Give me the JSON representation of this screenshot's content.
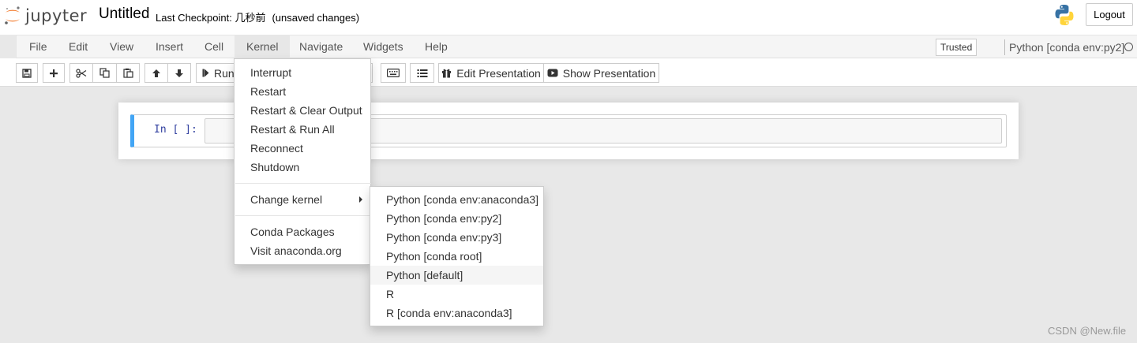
{
  "header": {
    "logo_text": "jupyter",
    "notebook_title": "Untitled",
    "checkpoint_text": "Last Checkpoint: 几秒前",
    "unsaved_text": "(unsaved changes)",
    "logout_label": "Logout"
  },
  "menubar": {
    "items": [
      {
        "label": "File"
      },
      {
        "label": "Edit"
      },
      {
        "label": "View"
      },
      {
        "label": "Insert"
      },
      {
        "label": "Cell"
      },
      {
        "label": "Kernel"
      },
      {
        "label": "Navigate"
      },
      {
        "label": "Widgets"
      },
      {
        "label": "Help"
      }
    ],
    "active_menu": "Kernel",
    "trusted_label": "Trusted",
    "kernel_name": "Python [conda env:py2]"
  },
  "toolbar": {
    "run_label": "Run",
    "edit_presentation_label": "Edit Presentation",
    "show_presentation_label": "Show Presentation"
  },
  "cell": {
    "prompt": "In [ ]:",
    "content": ""
  },
  "kernel_menu": {
    "items": [
      {
        "label": "Interrupt"
      },
      {
        "label": "Restart"
      },
      {
        "label": "Restart & Clear Output"
      },
      {
        "label": "Restart & Run All"
      },
      {
        "label": "Reconnect"
      },
      {
        "label": "Shutdown"
      },
      {
        "label": "Change kernel"
      },
      {
        "label": "Conda Packages"
      },
      {
        "label": "Visit anaconda.org"
      }
    ]
  },
  "change_kernel_submenu": {
    "items": [
      {
        "label": "Python [conda env:anaconda3]"
      },
      {
        "label": "Python [conda env:py2]"
      },
      {
        "label": "Python [conda env:py3]"
      },
      {
        "label": "Python [conda root]"
      },
      {
        "label": "Python [default]"
      },
      {
        "label": "R"
      },
      {
        "label": "R [conda env:anaconda3]"
      }
    ],
    "hovered_item": "Python [default]"
  },
  "watermark": "CSDN @New.file",
  "colors": {
    "cell_selected_border": "#42A5F5",
    "prompt_color": "#303F9F",
    "jupyter_orange": "#F37726"
  }
}
